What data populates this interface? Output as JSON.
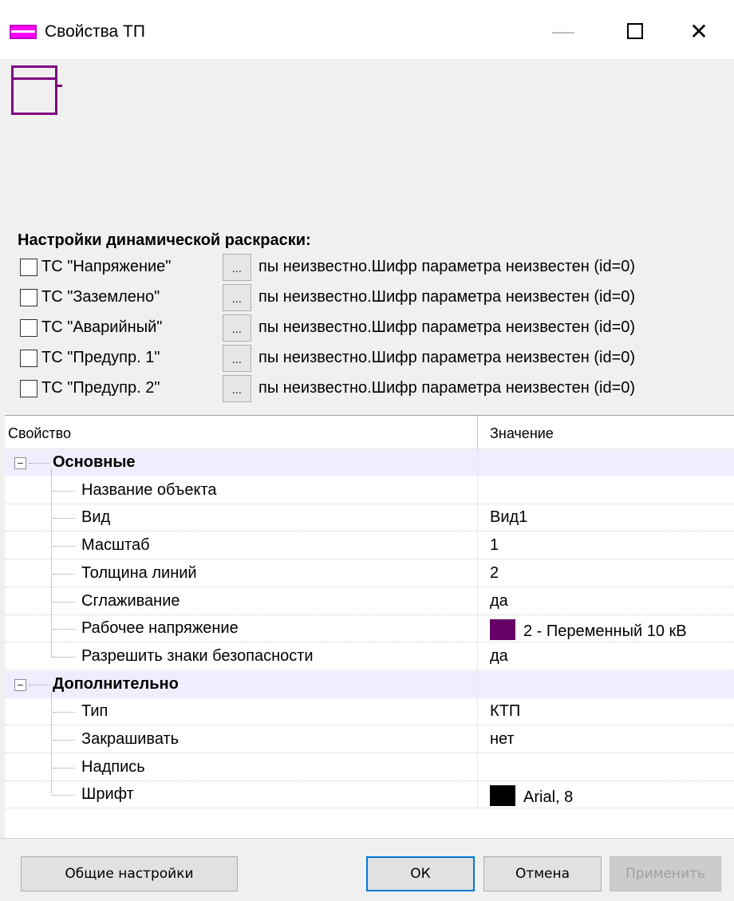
{
  "window": {
    "title": "Свойства ТП",
    "minimize_glyph": "—",
    "close_glyph": "✕",
    "colors": {
      "accent": "#800080",
      "title_icon": "#ff00ff",
      "category_bg": "#eeeeff",
      "focus_border": "#0078d7"
    }
  },
  "dynamic": {
    "title": "Настройки динамической раскраски:",
    "dots_label": "...",
    "rows": [
      {
        "label": "ТС \"Напряжение\"",
        "checked": false,
        "value": "пы неизвестно.Шифр параметра неизвестен (id=0)"
      },
      {
        "label": "ТС \"Заземлено\"",
        "checked": false,
        "value": "пы неизвестно.Шифр параметра неизвестен (id=0)"
      },
      {
        "label": "ТС \"Аварийный\"",
        "checked": false,
        "value": "пы неизвестно.Шифр параметра неизвестен (id=0)"
      },
      {
        "label": "ТС \"Предупр. 1\"",
        "checked": false,
        "value": "пы неизвестно.Шифр параметра неизвестен (id=0)"
      },
      {
        "label": "ТС \"Предупр. 2\"",
        "checked": false,
        "value": "пы неизвестно.Шифр параметра неизвестен (id=0)"
      }
    ]
  },
  "grid": {
    "header_property": "Свойство",
    "header_value": "Значение",
    "expander_glyph": "−",
    "categories": [
      {
        "name": "Основные",
        "expanded": true,
        "rows": [
          {
            "name": "Название объекта",
            "value": ""
          },
          {
            "name": "Вид",
            "value": "Вид1"
          },
          {
            "name": "Масштаб",
            "value": "1"
          },
          {
            "name": "Толщина линий",
            "value": "2"
          },
          {
            "name": "Сглаживание",
            "value": "да"
          },
          {
            "name": "Рабочее напряжение",
            "value": "2 - Переменный 10 кВ",
            "swatch": "#660066"
          },
          {
            "name": "Разрешить знаки безопасности",
            "value": "да"
          }
        ]
      },
      {
        "name": "Дополнительно",
        "expanded": true,
        "rows": [
          {
            "name": "Тип",
            "value": "КТП"
          },
          {
            "name": "Закрашивать",
            "value": "нет"
          },
          {
            "name": "Надпись",
            "value": ""
          },
          {
            "name": "Шрифт",
            "value": "Arial, 8",
            "swatch": "#000000"
          }
        ]
      }
    ]
  },
  "footer": {
    "general_settings": "Общие настройки",
    "ok": "ОК",
    "cancel": "Отмена",
    "apply": "Применить"
  }
}
